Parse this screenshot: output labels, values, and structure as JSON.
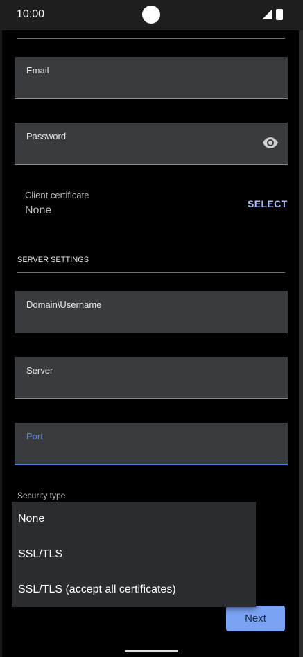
{
  "status_bar": {
    "time": "10:00"
  },
  "account": {
    "email_label": "Email",
    "password_label": "Password",
    "client_certificate_label": "Client certificate",
    "client_certificate_value": "None",
    "select_label": "SELECT"
  },
  "server_settings": {
    "section_title": "SERVER SETTINGS",
    "domain_username_label": "Domain\\Username",
    "server_label": "Server",
    "port_label": "Port",
    "security_type_label": "Security type"
  },
  "security_dropdown": {
    "options": [
      "None",
      "SSL/TLS",
      "SSL/TLS (accept all certificates)"
    ]
  },
  "next_label": "Next",
  "colors": {
    "accent": "#4c7be0",
    "button": "#7aa3f3",
    "field_bg": "#3a3b3e"
  }
}
